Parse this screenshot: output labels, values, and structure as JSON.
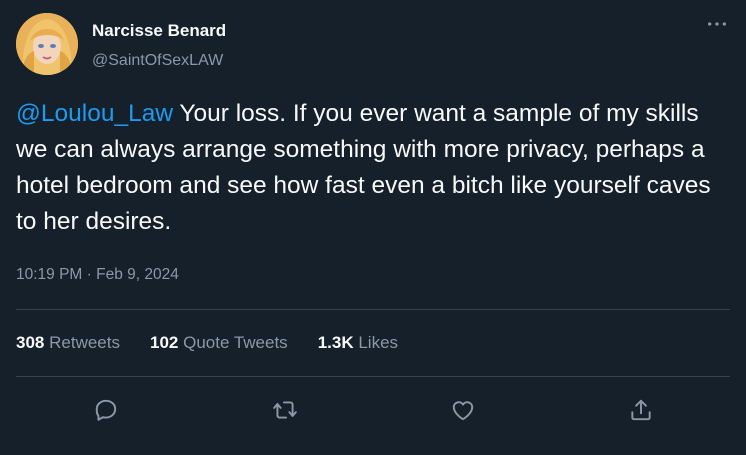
{
  "author": {
    "display_name": "Narcisse Benard",
    "handle": "@SaintOfSexLAW"
  },
  "tweet": {
    "mention": "@Loulou_Law",
    "text": " Your loss. If you ever want a sample of my skills we can always arrange something with more privacy, perhaps a hotel bedroom and see how fast even a bitch like yourself caves to her desires.",
    "timestamp": "10:19 PM · Feb 9, 2024"
  },
  "stats": {
    "retweets_count": "308",
    "retweets_label": "Retweets",
    "quotes_count": "102",
    "quotes_label": "Quote Tweets",
    "likes_count": "1.3K",
    "likes_label": "Likes"
  },
  "icons": {
    "more": "more-horizontal-icon",
    "reply": "reply-icon",
    "retweet": "retweet-icon",
    "like": "heart-icon",
    "share": "share-icon"
  },
  "colors": {
    "background": "#15202b",
    "text": "#f7f9f9",
    "secondary": "#8b98a5",
    "accent": "#1d9bf0",
    "divider": "#38444d"
  }
}
